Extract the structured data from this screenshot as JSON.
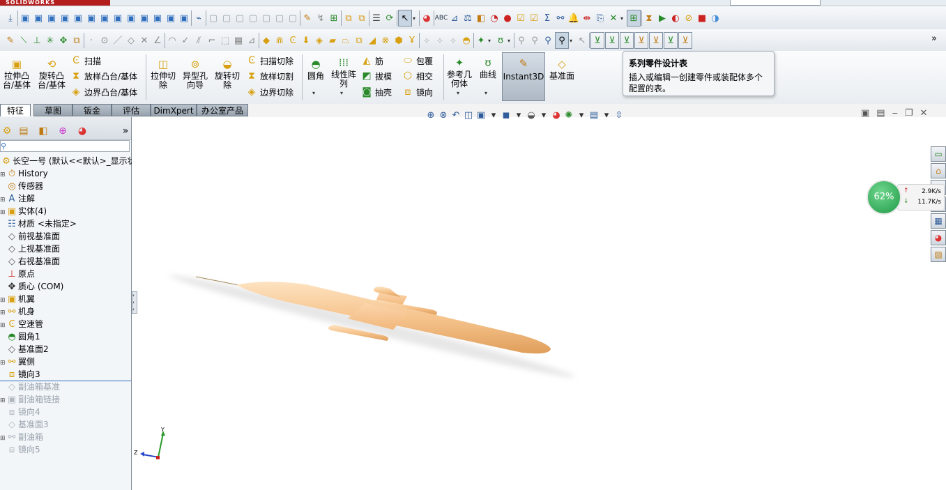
{
  "app": {
    "brand": "SOLIDWORKS"
  },
  "tooltip": {
    "title": "系列零件设计表",
    "description": "插入或编辑一创建零件或装配体多个配置的表。"
  },
  "command_manager": {
    "extrude_boss": "拉伸凸台/基体",
    "revolve_boss": "旋转凸台/基体",
    "sweep": "扫描",
    "loft_boss": "放样凸台/基体",
    "boundary_boss": "边界凸台/基体",
    "extrude_cut": "拉伸切除",
    "hole_wizard": "异型孔向导",
    "revolve_cut": "旋转切除",
    "swept_cut": "扫描切除",
    "lofted_cut": "放样切割",
    "boundary_cut": "边界切除",
    "fillet": "圆角",
    "linear_pattern": "线性阵列",
    "rib": "筋",
    "draft": "拔模",
    "shell": "抽壳",
    "wrap": "包覆",
    "intersect": "相交",
    "mirror": "镜向",
    "ref_geometry": "参考几何体",
    "curves": "曲线",
    "instant3d": "Instant3D",
    "plane": "基准面"
  },
  "tabs": [
    {
      "label": "特征",
      "active": true
    },
    {
      "label": "草图"
    },
    {
      "label": "钣金"
    },
    {
      "label": "评估"
    },
    {
      "label": "DimXpert"
    },
    {
      "label": "办公室产品"
    }
  ],
  "tree": {
    "root": "长空一号  (默认<<默认>_显示状",
    "items": [
      {
        "label": "History",
        "icon": "history-icon",
        "expand": true
      },
      {
        "label": "传感器",
        "icon": "sensor-icon"
      },
      {
        "label": "注解",
        "icon": "annotation-icon",
        "expand": true
      },
      {
        "label": "实体(4)",
        "icon": "solid-bodies-icon",
        "expand": true
      },
      {
        "label": "材质 <未指定>",
        "icon": "material-icon"
      },
      {
        "label": "前视基准面",
        "icon": "plane-icon"
      },
      {
        "label": "上视基准面",
        "icon": "plane-icon"
      },
      {
        "label": "右视基准面",
        "icon": "plane-icon"
      },
      {
        "label": "原点",
        "icon": "origin-icon"
      },
      {
        "label": "质心 (COM)",
        "icon": "center-of-mass-icon"
      },
      {
        "label": "机翼",
        "icon": "extrude-feature-icon",
        "expand": true
      },
      {
        "label": "机身",
        "icon": "revolve-feature-icon",
        "expand": true
      },
      {
        "label": "空速管",
        "icon": "sweep-feature-icon",
        "expand": true
      },
      {
        "label": "圆角1",
        "icon": "fillet-feature-icon"
      },
      {
        "label": "基准面2",
        "icon": "plane-icon"
      },
      {
        "label": "翼侧",
        "icon": "revolve-feature-icon",
        "expand": true
      },
      {
        "label": "镜向3",
        "icon": "mirror-feature-icon"
      },
      {
        "label": "副油箱基准",
        "icon": "plane-icon",
        "dim": true
      },
      {
        "label": "副油箱链接",
        "icon": "extrude-feature-icon",
        "dim": true,
        "expand": true
      },
      {
        "label": "镜向4",
        "icon": "mirror-feature-icon",
        "dim": true
      },
      {
        "label": "基准面3",
        "icon": "plane-icon",
        "dim": true
      },
      {
        "label": "副油箱",
        "icon": "revolve-feature-icon",
        "dim": true,
        "expand": true
      },
      {
        "label": "镜向5",
        "icon": "mirror-feature-icon",
        "dim": true
      }
    ]
  },
  "network": {
    "percent": "62%",
    "up": "2.9K/s",
    "down": "11.7K/s"
  },
  "triad": {
    "x": "",
    "y": "Y",
    "z": "Z"
  },
  "colors": {
    "model": "#f6c48d",
    "accent": "#2f6fbd",
    "selected": "#c8d5e3"
  }
}
